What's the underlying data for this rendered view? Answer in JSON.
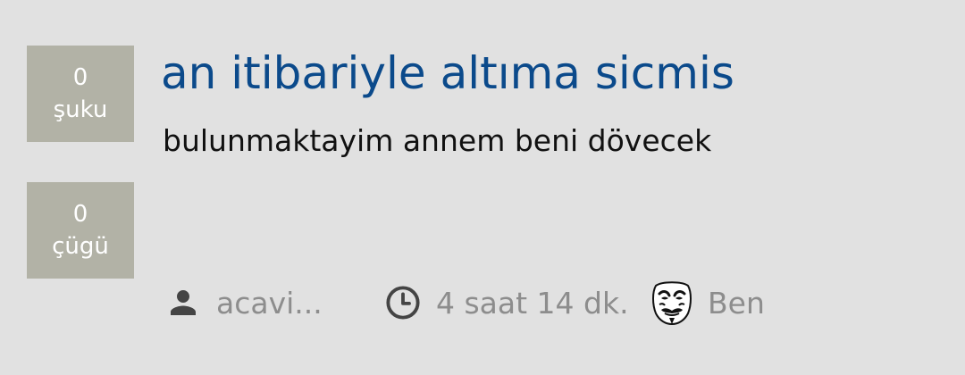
{
  "votes": {
    "up": {
      "count": "0",
      "label": "şuku"
    },
    "down": {
      "count": "0",
      "label": "çügü"
    }
  },
  "post": {
    "title": "an itibariyle altıma sicmis",
    "body": "bulunmaktayim annem beni dövecek"
  },
  "meta": {
    "author": "acavi...",
    "author_icon": "person-icon",
    "time": "4 saat 14 dk.",
    "time_icon": "clock-icon",
    "ben_label": "Ben",
    "ben_icon": "anonymous-mask-icon"
  },
  "colors": {
    "background": "#e1e1e1",
    "vote_box": "#b2b2a6",
    "title": "#0b4a8b",
    "body_text": "#111111",
    "meta_text": "#8d8d8d"
  }
}
